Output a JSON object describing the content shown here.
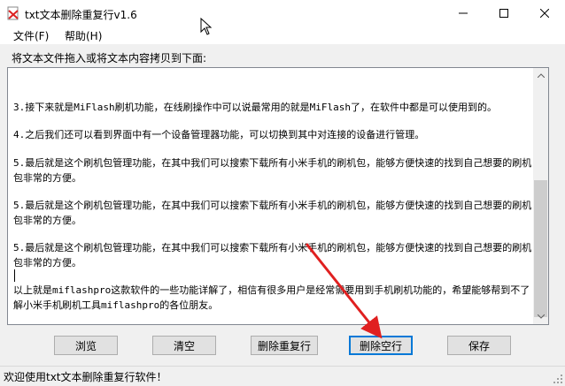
{
  "window": {
    "title": "txt文本删除重复行v1.6"
  },
  "menu": {
    "file": "文件(F)",
    "help": "帮助(H)"
  },
  "instruction": "将文本文件拖入或将文本内容拷贝到下面:",
  "paragraphs": [
    "3.接下来就是MiFlash刷机功能，在线刷操作中可以说最常用的就是MiFlash了，在软件中都是可以使用到的。",
    "4.之后我们还可以看到界面中有一个设备管理器功能，可以切换到其中对连接的设备进行管理。",
    "5.最后就是这个刷机包管理功能，在其中我们可以搜索下载所有小米手机的刷机包，能够方便快速的找到自己想要的刷机包非常的方便。",
    "5.最后就是这个刷机包管理功能，在其中我们可以搜索下载所有小米手机的刷机包，能够方便快速的找到自己想要的刷机包非常的方便。",
    "5.最后就是这个刷机包管理功能，在其中我们可以搜索下载所有小米手机的刷机包，能够方便快速的找到自己想要的刷机包非常的方便。",
    "以上就是miflashpro这款软件的一些功能详解了，相信有很多用户是经常需要用到手机刷机功能的，希望能够帮到不了解小米手机刷机工具miflashpro的各位朋友。"
  ],
  "buttons": {
    "browse": "浏览",
    "clear": "清空",
    "remove_duplicates": "删除重复行",
    "remove_blank": "删除空行",
    "save": "保存"
  },
  "status": "欢迎使用txt文本删除重复行软件！",
  "colors": {
    "arrow": "#e02020",
    "focus": "#0078d7"
  }
}
